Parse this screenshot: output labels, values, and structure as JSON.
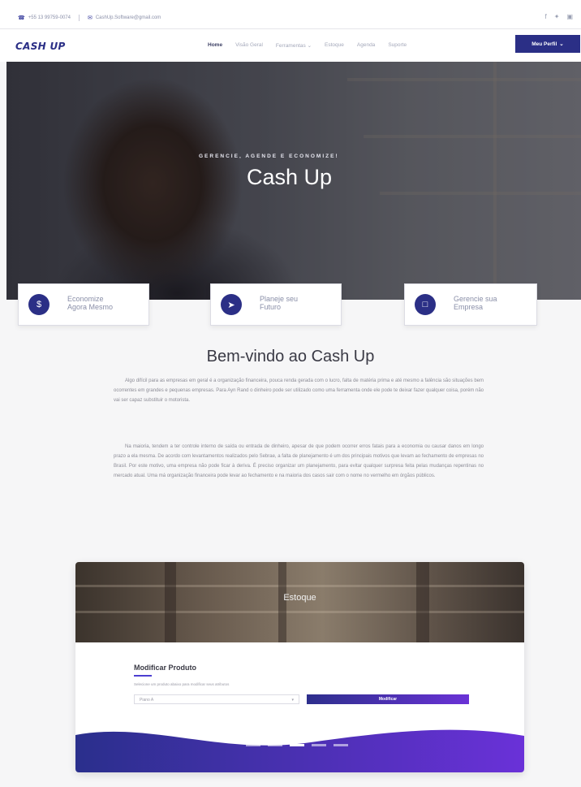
{
  "topbar": {
    "phone": "+55 13 99759-0074",
    "email": "CashUp.Software@gmail.com",
    "social": [
      "facebook-icon",
      "twitter-icon",
      "instagram-icon"
    ]
  },
  "nav": {
    "logo": "CASH UP",
    "items": [
      {
        "label": "Home",
        "active": true
      },
      {
        "label": "Visão Geral",
        "active": false
      },
      {
        "label": "Ferramentas",
        "active": false
      },
      {
        "label": "Estoque",
        "active": false
      },
      {
        "label": "Agenda",
        "active": false
      },
      {
        "label": "Suporte",
        "active": false
      }
    ],
    "profile": "Meu Perfil"
  },
  "hero": {
    "eyebrow": "GERENCIE, AGENDE E ECONOMIZE!",
    "title": "Cash Up"
  },
  "features": [
    {
      "label_1": "Economize",
      "label_2": "Agora Mesmo",
      "icon": "money-icon"
    },
    {
      "label_1": "Planeje seu",
      "label_2": "Futuro",
      "icon": "send-icon"
    },
    {
      "label_1": "Gerencie sua",
      "label_2": "Empresa",
      "icon": "calendar-icon"
    }
  ],
  "welcome": {
    "title": "Bem-vindo ao Cash Up",
    "paragraph_1": "Algo difícil para as empresas em geral é a organização financeira, pouca renda gerada com o lucro, falta de matéria prima e até mesmo a falência são situações bem ocorrentes em grandes e pequenas empresas. Para Ayn Rand o dinheiro pode ser utilizado como uma ferramenta onde ele pode te deixar fazer qualquer coisa, porém não vai ser capaz substituir o motorista.",
    "paragraph_2": "Na maioria, tendem a ter controle interno de saída ou entrada de dinheiro, apesar de que podem ocorrer erros fatais para a economia ou causar danos em longo prazo a ela mesma. De acordo com levantamentos realizados pelo Sebrae, a falta de planejamento é um dos principais motivos que levam ao fechamento de empresas no Brasil. Por este motivo, uma empresa não pode ficar à deriva. É preciso organizar um planejamento, para evitar qualquer surpresa feita pelas mudanças repentinas no mercado atual. Uma má organização financeira pode levar ao fechamento e na maioria dos casos sair com o nome no vermelho em órgãos públicos."
  },
  "showcase": {
    "title": "Estoque",
    "form_title": "Modificar Produto",
    "form_subtitle": "Selecione um produto abaixo para modificar seus atributos",
    "select_value": "Piano A",
    "button": "Modificar",
    "slides": 5,
    "active_slide": 3
  },
  "colors": {
    "brand": "#2b2f86",
    "accent": "#5b35d5"
  }
}
